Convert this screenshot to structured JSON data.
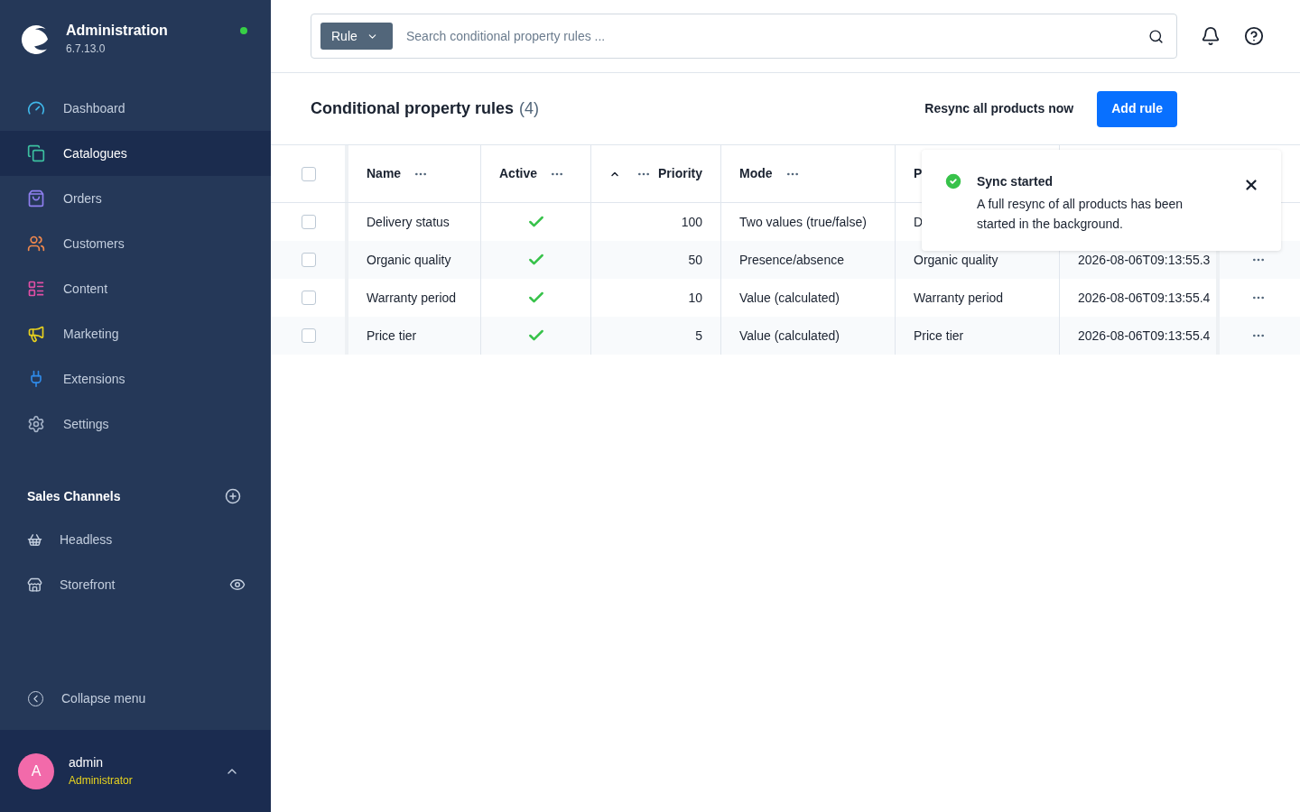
{
  "sidebar": {
    "brand": {
      "title": "Administration",
      "version": "6.7.13.0"
    },
    "nav": [
      {
        "label": "Dashboard",
        "selected": false
      },
      {
        "label": "Catalogues",
        "selected": true
      },
      {
        "label": "Orders",
        "selected": false
      },
      {
        "label": "Customers",
        "selected": false
      },
      {
        "label": "Content",
        "selected": false
      },
      {
        "label": "Marketing",
        "selected": false
      },
      {
        "label": "Extensions",
        "selected": false
      },
      {
        "label": "Settings",
        "selected": false
      }
    ],
    "sales_channels": {
      "title": "Sales Channels",
      "items": [
        {
          "label": "Headless",
          "preview": false
        },
        {
          "label": "Storefront",
          "preview": true
        }
      ]
    },
    "collapse": "Collapse menu",
    "user": {
      "initial": "A",
      "name": "admin",
      "role": "Administrator"
    }
  },
  "search": {
    "type_button": "Rule",
    "placeholder": "Search conditional property rules ..."
  },
  "page": {
    "title": "Conditional property rules",
    "count": "(4)",
    "secondary_action": "Resync all products now",
    "primary_action": "Add rule"
  },
  "table": {
    "all_checked": false,
    "columns": [
      {
        "label": "Name",
        "sorted": false
      },
      {
        "label": "Active",
        "sorted": false
      },
      {
        "label": "Priority",
        "sorted": true
      },
      {
        "label": "Mode",
        "sorted": false
      },
      {
        "label": "P",
        "sorted": false
      }
    ],
    "rows": [
      {
        "checked": false,
        "name": "Delivery status",
        "active": true,
        "priority": "100",
        "mode": "Two values (true/false)",
        "column_5": "D",
        "menu": false
      },
      {
        "checked": false,
        "name": "Organic quality",
        "active": true,
        "priority": "50",
        "mode": "Presence/absence",
        "column_5": "Organic quality",
        "column_6": "2026-08-06T09:13:55.3",
        "menu": true
      },
      {
        "checked": false,
        "name": "Warranty period",
        "active": true,
        "priority": "10",
        "mode": "Value (calculated)",
        "column_5": "Warranty period",
        "column_6": "2026-08-06T09:13:55.4",
        "menu": true
      },
      {
        "checked": false,
        "name": "Price tier",
        "active": true,
        "priority": "5",
        "mode": "Value (calculated)",
        "column_5": "Price tier",
        "column_6": "2026-08-06T09:13:55.4",
        "menu": true
      }
    ]
  },
  "toast": {
    "title": "Sync started",
    "message": "A full resync of all products has been started in the background."
  }
}
